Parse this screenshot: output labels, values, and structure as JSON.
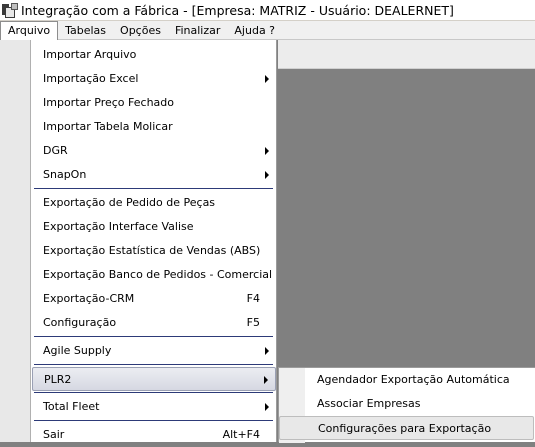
{
  "window": {
    "title": "Integração com a Fábrica - [Empresa: MATRIZ - Usuário: DEALERNET]"
  },
  "menubar": {
    "items": [
      "Arquivo",
      "Tabelas",
      "Opções",
      "Finalizar",
      "Ajuda ?"
    ]
  },
  "arquivo_menu": {
    "items": [
      {
        "label": "Importar Arquivo",
        "shortcut": "",
        "has_submenu": false
      },
      {
        "label": "Importação Excel",
        "shortcut": "",
        "has_submenu": true
      },
      {
        "label": "Importar Preço Fechado",
        "shortcut": "",
        "has_submenu": false
      },
      {
        "label": "Importar Tabela Molicar",
        "shortcut": "",
        "has_submenu": false
      },
      {
        "label": "DGR",
        "shortcut": "",
        "has_submenu": true
      },
      {
        "label": "SnapOn",
        "shortcut": "",
        "has_submenu": true
      },
      {
        "label": "Exportação de Pedido de Peças",
        "shortcut": "",
        "has_submenu": false
      },
      {
        "label": "Exportação Interface Valise",
        "shortcut": "",
        "has_submenu": false
      },
      {
        "label": "Exportação Estatística de Vendas (ABS)",
        "shortcut": "",
        "has_submenu": false
      },
      {
        "label": "Exportação Banco de Pedidos - Comercial",
        "shortcut": "",
        "has_submenu": false
      },
      {
        "label": "Exportação-CRM",
        "shortcut": "F4",
        "has_submenu": false
      },
      {
        "label": "Configuração",
        "shortcut": "F5",
        "has_submenu": false
      },
      {
        "label": "Agile Supply",
        "shortcut": "",
        "has_submenu": true
      },
      {
        "label": "PLR2",
        "shortcut": "",
        "has_submenu": true
      },
      {
        "label": "Total Fleet",
        "shortcut": "",
        "has_submenu": true
      },
      {
        "label": "Sair",
        "shortcut": "Alt+F4",
        "has_submenu": false
      }
    ]
  },
  "plr2_submenu": {
    "items": [
      "Agendador Exportação Automática",
      "Associar Empresas",
      "Configurações para Exportação"
    ]
  }
}
